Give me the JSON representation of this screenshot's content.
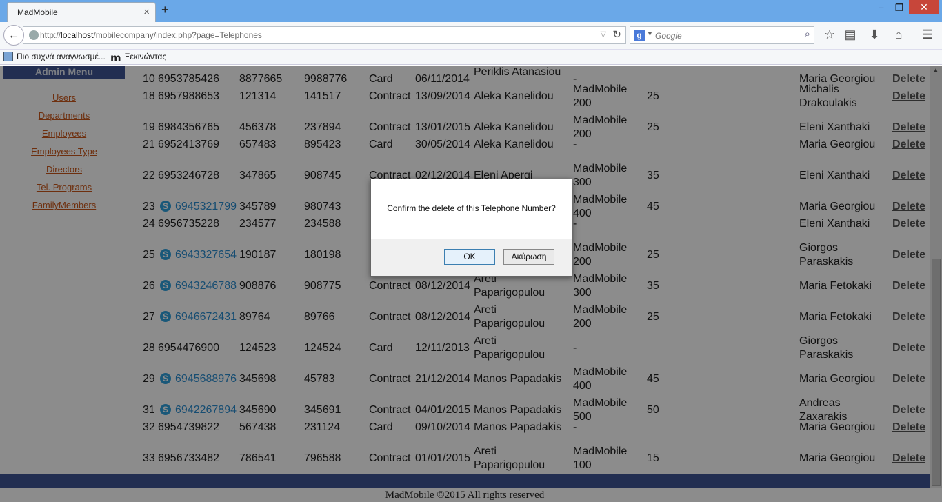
{
  "browser": {
    "tab_title": "MadMobile",
    "tab_close": "×",
    "new_tab": "+",
    "url_prefix": "http://",
    "url_host": "localhost",
    "url_path": "/mobilecompany/index.php?page=Telephones",
    "search_engine": "g",
    "search_placeholder": "Google",
    "window_min": "−",
    "window_max": "❐",
    "window_close": "✕",
    "bookmarks": [
      {
        "label": "Πιο συχνά αναγνωσμέ...",
        "icon": "bookmark-page-icon"
      },
      {
        "label": "Ξεκινώντας",
        "icon": "m-logo-icon"
      }
    ]
  },
  "sidebar": {
    "header": "Admin Menu",
    "links": [
      "Users",
      "Departments",
      "Employees",
      "Employees Type",
      "Directors",
      "Tel. Programs",
      "FamilyMembers"
    ]
  },
  "table": {
    "delete_label": "Delete",
    "rows": [
      {
        "id": "10",
        "phone": "6953785426",
        "skype": false,
        "c1": "8877665",
        "c2": "9988776",
        "type": "Card",
        "date": "06/11/2014",
        "customer": "Periklis Atanasiou",
        "program": "-",
        "amount": "",
        "employee": "Maria Georgiou"
      },
      {
        "id": "18",
        "phone": "6957988653",
        "skype": false,
        "c1": "121314",
        "c2": "141517",
        "type": "Contract",
        "date": "13/09/2014",
        "customer": "Aleka Kanelidou",
        "program": "MadMobile 200",
        "amount": "25",
        "employee": "Michalis Drakoulakis"
      },
      {
        "id": "19",
        "phone": "6984356765",
        "skype": false,
        "c1": "456378",
        "c2": "237894",
        "type": "Contract",
        "date": "13/01/2015",
        "customer": "Aleka Kanelidou",
        "program": "MadMobile 200",
        "amount": "25",
        "employee": "Eleni Xanthaki"
      },
      {
        "id": "21",
        "phone": "6952413769",
        "skype": false,
        "c1": "657483",
        "c2": "895423",
        "type": "Card",
        "date": "30/05/2014",
        "customer": "Aleka Kanelidou",
        "program": "-",
        "amount": "",
        "employee": "Maria Georgiou"
      },
      {
        "id": "22",
        "phone": "6953246728",
        "skype": false,
        "c1": "347865",
        "c2": "908745",
        "type": "Contract",
        "date": "02/12/2014",
        "customer": "Eleni Apergi",
        "program": "MadMobile 300",
        "amount": "35",
        "employee": "Eleni Xanthaki"
      },
      {
        "id": "23",
        "phone": "6945321799",
        "skype": true,
        "c1": "345789",
        "c2": "980743",
        "type": "",
        "date": "",
        "customer": "",
        "program": "MadMobile 400",
        "amount": "45",
        "employee": "Maria Georgiou"
      },
      {
        "id": "24",
        "phone": "6956735228",
        "skype": false,
        "c1": "234577",
        "c2": "234588",
        "type": "",
        "date": "",
        "customer": "",
        "program": "-",
        "amount": "",
        "employee": "Eleni Xanthaki"
      },
      {
        "id": "25",
        "phone": "6943327654",
        "skype": true,
        "c1": "190187",
        "c2": "180198",
        "type": "",
        "date": "",
        "customer": "",
        "program": "MadMobile 200",
        "amount": "25",
        "employee": "Giorgos Paraskakis"
      },
      {
        "id": "26",
        "phone": "6943246788",
        "skype": true,
        "c1": "908876",
        "c2": "908775",
        "type": "Contract",
        "date": "08/12/2014",
        "customer": "Areti Paparigopulou",
        "program": "MadMobile 300",
        "amount": "35",
        "employee": "Maria Fetokaki"
      },
      {
        "id": "27",
        "phone": "6946672431",
        "skype": true,
        "c1": "89764",
        "c2": "89766",
        "type": "Contract",
        "date": "08/12/2014",
        "customer": "Areti Paparigopulou",
        "program": "MadMobile 200",
        "amount": "25",
        "employee": "Maria Fetokaki"
      },
      {
        "id": "28",
        "phone": "6954476900",
        "skype": false,
        "c1": "124523",
        "c2": "124524",
        "type": "Card",
        "date": "12/11/2013",
        "customer": "Areti Paparigopulou",
        "program": "-",
        "amount": "",
        "employee": "Giorgos Paraskakis"
      },
      {
        "id": "29",
        "phone": "6945688976",
        "skype": true,
        "c1": "345698",
        "c2": "45783",
        "type": "Contract",
        "date": "21/12/2014",
        "customer": "Manos Papadakis",
        "program": "MadMobile 400",
        "amount": "45",
        "employee": "Maria Georgiou"
      },
      {
        "id": "31",
        "phone": "6942267894",
        "skype": true,
        "c1": "345690",
        "c2": "345691",
        "type": "Contract",
        "date": "04/01/2015",
        "customer": "Manos Papadakis",
        "program": "MadMobile 500",
        "amount": "50",
        "employee": "Andreas Zaxarakis"
      },
      {
        "id": "32",
        "phone": "6954739822",
        "skype": false,
        "c1": "567438",
        "c2": "231124",
        "type": "Card",
        "date": "09/10/2014",
        "customer": "Manos Papadakis",
        "program": "-",
        "amount": "",
        "employee": "Maria Georgiou"
      },
      {
        "id": "33",
        "phone": "6956733482",
        "skype": false,
        "c1": "786541",
        "c2": "796588",
        "type": "Contract",
        "date": "01/01/2015",
        "customer": "Areti Paparigopulou",
        "program": "MadMobile 100",
        "amount": "15",
        "employee": "Maria Georgiou"
      }
    ]
  },
  "footer": "MadMobile ©2015 All rights reserved",
  "dialog": {
    "message": "Confirm the delete of this Telephone Number?",
    "ok_label": "OK",
    "cancel_label": "Ακύρωση"
  },
  "colors": {
    "titlebar": "#6aa8e8",
    "brand_band": "#3f5494",
    "sidebar_link": "#c9571a",
    "skype": "#2ea0dd"
  }
}
